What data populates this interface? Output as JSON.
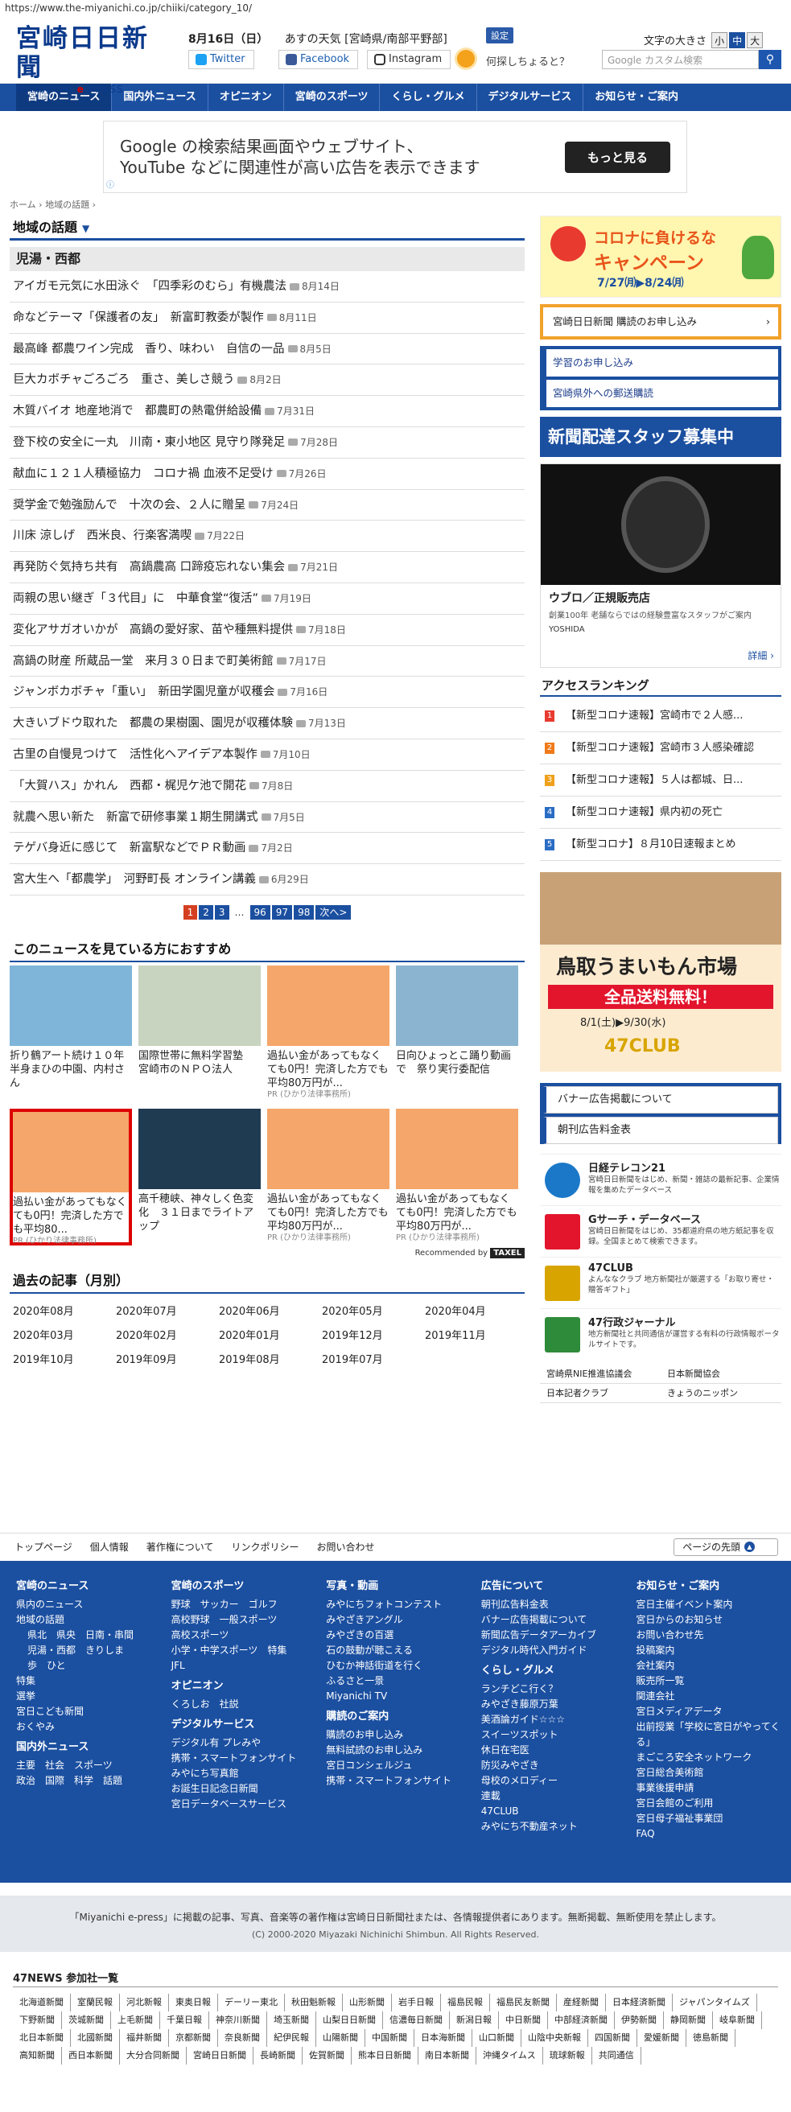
{
  "browser": {
    "url": "https://www.the-miyanichi.co.jp/chiiki/category_10/"
  },
  "header": {
    "logo_main": "宮崎日日新聞",
    "logo_sub_a": "MIYANICHI ",
    "logo_sub_b": "e",
    "logo_sub_c": "-PRESS",
    "date": "8月16日（日）",
    "weather": "あすの天気 [宮崎県/南部平野部]",
    "settings": "設定",
    "font_size_label": "文字の大きさ",
    "font_sizes": [
      "小",
      "中",
      "大"
    ],
    "twitter": "Twitter",
    "facebook": "Facebook",
    "instagram": "Instagram",
    "ask": "何探しちょると？",
    "search_placeholder": "Google カスタム検索",
    "search_icon": "search-icon"
  },
  "nav": [
    "宮崎のニュース",
    "国内外ニュース",
    "オピニオン",
    "宮崎のスポーツ",
    "くらし・グルメ",
    "デジタルサービス",
    "お知らせ・ご案内"
  ],
  "ad_top": {
    "text1": "Google の検索結果画面やウェブサイト、",
    "text2": "YouTube などに関連性が高い広告を表示できます",
    "button": "もっと見る",
    "info": "ⓘ"
  },
  "breadcrumb": {
    "home": "ホーム",
    "sep": "›",
    "current": "地域の話題",
    "end": "›"
  },
  "section_title": "地域の話題",
  "section_arrow": "▼",
  "subsection": "児湯・西都",
  "articles": [
    {
      "title": "アイガモ元気に水田泳ぐ　「四季彩のむら」有機農法",
      "date": "8月14日"
    },
    {
      "title": "命などテーマ「保護者の友」　新富町教委が製作",
      "date": "8月11日"
    },
    {
      "title": "最高峰 都農ワイン完成　香り、味わい　自信の一品",
      "date": "8月5日"
    },
    {
      "title": "巨大カボチャごろごろ　重さ、美しさ競う",
      "date": "8月2日"
    },
    {
      "title": "木質バイオ 地産地消で　都農町の熱電併給設備",
      "date": "7月31日"
    },
    {
      "title": "登下校の安全に一丸　川南・東小地区 見守り隊発足",
      "date": "7月28日"
    },
    {
      "title": "献血に１２１人積極協力　コロナ禍 血液不足受け",
      "date": "7月26日"
    },
    {
      "title": "奨学金で勉強励んで　十次の会、２人に贈呈",
      "date": "7月24日"
    },
    {
      "title": "川床 涼しげ　西米良、行楽客満喫",
      "date": "7月22日"
    },
    {
      "title": "再発防ぐ気持ち共有　高鍋農高 口蹄疫忘れない集会",
      "date": "7月21日"
    },
    {
      "title": "両親の思い継ぎ「３代目」に　中華食堂“復活”",
      "date": "7月19日"
    },
    {
      "title": "変化アサガオいかが　高鍋の愛好家、苗や種無料提供",
      "date": "7月18日"
    },
    {
      "title": "高鍋の財産 所蔵品一堂　来月３０日まで町美術館",
      "date": "7月17日"
    },
    {
      "title": "ジャンボカボチャ「重い」　新田学園児童が収穫会",
      "date": "7月16日"
    },
    {
      "title": "大きいブドウ取れた　都農の果樹園、園児が収穫体験",
      "date": "7月13日"
    },
    {
      "title": "古里の自慢見つけて　活性化ヘアイデア本製作",
      "date": "7月10日"
    },
    {
      "title": "「大賀ハス」かれん　西都・梶児ケ池で開花",
      "date": "7月8日"
    },
    {
      "title": "就農へ思い新た　新富で研修事業１期生開講式",
      "date": "7月5日"
    },
    {
      "title": "テゲバ身近に感じて　新富駅などでＰＲ動画",
      "date": "7月2日"
    },
    {
      "title": "宮大生へ「都農学」　河野町長 オンライン講義",
      "date": "6月29日"
    }
  ],
  "pager": {
    "pages": [
      "1",
      "2",
      "3",
      "…",
      "96",
      "97",
      "98",
      "次へ>"
    ]
  },
  "recommend_title": "このニュースを見ている方におすすめ",
  "recommend": [
    {
      "text": "折り鶴アート続け１０年 半身まひの中園、内村さん",
      "pr": ""
    },
    {
      "text": "国際世帯に無料学習塾　宮崎市のＮＰＯ法人",
      "pr": ""
    },
    {
      "text": "過払い金があってもなくても0円！完済した方でも平均80万円が...",
      "pr": "PR (ひかり法律事務所)"
    },
    {
      "text": "日向ひょっとこ踊り動画で　祭り実行委配信",
      "pr": ""
    },
    {
      "text": "過払い金があってもなくても0円！完済した方でも平均80...",
      "pr": "PR (ひかり法律事務所)"
    },
    {
      "text": "高千穂峡、神々しく色変化　３１日までライトアップ",
      "pr": ""
    },
    {
      "text": "過払い金があってもなくても0円！完済した方でも平均80万円が...",
      "pr": "PR (ひかり法律事務所)"
    },
    {
      "text": "過払い金があってもなくても0円！完済した方でも平均80万円が...",
      "pr": "PR (ひかり法律事務所)"
    }
  ],
  "recommended_by": "Recommended by",
  "recommended_logo": "TAXEL",
  "past_title": "過去の記事（月別）",
  "months": [
    "2020年08月",
    "2020年07月",
    "2020年06月",
    "2020年05月",
    "2020年04月",
    "2020年03月",
    "2020年02月",
    "2020年01月",
    "2019年12月",
    "2019年11月",
    "2019年10月",
    "2019年09月",
    "2019年08月",
    "2019年07月"
  ],
  "side": {
    "campaign_a": "コロナに負けるな",
    "campaign_b": "キャンペーン",
    "campaign_dates": "7/27㈪▶8/24㈪",
    "subscribe": "宮崎日日新聞 購読のお申し込み",
    "gakusyu": "学習のお申し込み",
    "outside": "宮崎県外への郵送購読",
    "staff": "新聞配達スタッフ募集中",
    "watch_title": "ウブロ／正規販売店",
    "watch_desc": "創業100年 老舗ならではの経験豊富なスタッフがご案内",
    "watch_brand": "YOSHIDA",
    "watch_more": "詳細 ›",
    "ranking_title": "アクセスランキング",
    "ranking": [
      {
        "n": "1",
        "t": "【新型コロナ速報】宮崎市で２人感..."
      },
      {
        "n": "2",
        "t": "【新型コロナ速報】宮崎市３人感染確認"
      },
      {
        "n": "3",
        "t": "【新型コロナ速報】５人は都城、日..."
      },
      {
        "n": "4",
        "t": "【新型コロナ速報】県内初の死亡"
      },
      {
        "n": "5",
        "t": "【新型コロナ】８月10日速報まとめ"
      }
    ],
    "tottori_a": "鳥取うまいもん市場",
    "tottori_b": "全品送料無料！",
    "tottori_dates": "8/1(土)▶9/30(水)",
    "club": "47CLUB",
    "info_links": [
      "バナー広告掲載について",
      "朝刊広告料金表"
    ],
    "services": [
      {
        "h": "日経テレコン21",
        "p": "宮崎日日新聞をはじめ、新聞・雑誌の最新記事、企業情報を集めたデータベース"
      },
      {
        "h": "Gサーチ・データベース",
        "p": "宮崎日日新聞をはじめ、35都道府県の地方紙記事を収録。全国まとめて検索できます。"
      },
      {
        "h": "47CLUB",
        "p": "よんななクラブ 地方新聞社が厳選する「お取り寄せ・贈答ギフト」"
      },
      {
        "h": "47行政ジャーナル",
        "p": "地方新聞社と共同通信が運営する有料の行政情報ポータルサイトです。"
      }
    ],
    "links": [
      "宮崎県NIE推進協議会",
      "日本新聞協会",
      "日本記者クラブ",
      "きょうのニッポン"
    ]
  },
  "footlinks": [
    "トップページ",
    "個人情報",
    "著作権について",
    "リンクポリシー",
    "お問い合わせ"
  ],
  "pagetop": "ページの先頭",
  "footer": {
    "col1": {
      "h": "宮崎のニュース",
      "items": [
        "県内のニュース",
        "地域の話題"
      ],
      "areas": [
        [
          "県北",
          "県央",
          "日南・串間"
        ],
        [
          "児湯・西都",
          "きりしま"
        ],
        [
          "歩",
          "ひと"
        ]
      ],
      "more": [
        "特集",
        "選挙",
        "宮日こども新聞",
        "おくやみ"
      ],
      "h2": "国内外ニュース",
      "world": [
        [
          "主要",
          "社会",
          "スポーツ"
        ],
        [
          "政治",
          "国際",
          "科学",
          "話題"
        ]
      ]
    },
    "col2": {
      "h": "宮崎のスポーツ",
      "rows": [
        [
          "野球",
          "サッカー",
          "ゴルフ"
        ],
        [
          "高校野球",
          "一般スポーツ"
        ],
        [
          "高校スポーツ"
        ],
        [
          "小学・中学スポーツ",
          "特集"
        ],
        [
          "JFL"
        ]
      ],
      "h2": "オピニオン",
      "op": [
        [
          "くろしお",
          "社説"
        ]
      ],
      "h3": "デジタルサービス",
      "digital": [
        "デジタル有 プレみや",
        "携帯・スマートフォンサイト",
        "みやにち写真館",
        "お誕生日記念日新聞",
        "宮日データベースサービス"
      ]
    },
    "col3": {
      "h": "写真・動画",
      "items": [
        "みやにちフォトコンテスト",
        "みやざきアングル",
        "みやざきの百選",
        "石の鼓動が聴こえる",
        "ひむか神話街道を行く",
        "ふるさと一景",
        "Miyanichi TV"
      ],
      "h2": "購読のご案内",
      "items2": [
        "購読のお申し込み",
        "無料試読のお申し込み",
        "宮日コンシェルジュ",
        "携帯・スマートフォンサイト"
      ]
    },
    "col4": {
      "h": "広告について",
      "items": [
        "朝刊広告料金表",
        "バナー広告掲載について",
        "新聞広告データアーカイブ",
        "デジタル時代入門ガイド"
      ],
      "h2": "くらし・グルメ",
      "items2": [
        "ランチどこ行く？",
        "みやざき藤原万葉",
        "美酒論ガイド☆☆☆",
        "スイーツスポット",
        "休日在宅医",
        "防災みやざき",
        "母校のメロディー",
        "連載",
        "47CLUB",
        "みやにち不動産ネット"
      ]
    },
    "col5": {
      "h": "お知らせ・ご案内",
      "items": [
        "宮日主催イベント案内",
        "宮日からのお知らせ",
        "お問い合わせ先",
        "投稿案内",
        "会社案内",
        "販売所一覧",
        "関連会社",
        "宮日メディアデータ",
        "出前授業「学校に宮日がやってくる」",
        "まごころ安全ネットワーク",
        "宮日総合美術館",
        "事業後援申請",
        "宮日会館のご利用",
        "宮日母子福祉事業団",
        "FAQ"
      ]
    }
  },
  "copyright": {
    "notice": "「Miyanichi e-press」に掲載の記事、写真、音楽等の著作権は宮崎日日新聞社または、各情報提供者にあります。無断掲載、無断使用を禁止します。",
    "c": "(C) 2000-2020 Miyazaki Nichinichi Shimbun. All Rights Reserved."
  },
  "news47": {
    "h": "47NEWS 参加社一覧",
    "papers": [
      "北海道新聞",
      "室蘭民報",
      "河北新報",
      "東奥日報",
      "デーリー東北",
      "秋田魁新報",
      "山形新聞",
      "岩手日報",
      "福島民報",
      "福島民友新聞",
      "産経新聞",
      "日本経済新聞",
      "ジャパンタイムズ",
      "下野新聞",
      "茨城新聞",
      "上毛新聞",
      "千葉日報",
      "神奈川新聞",
      "埼玉新聞",
      "山梨日日新聞",
      "信濃毎日新聞",
      "新潟日報",
      "中日新聞",
      "中部経済新聞",
      "伊勢新聞",
      "静岡新聞",
      "岐阜新聞",
      "北日本新聞",
      "北國新聞",
      "福井新聞",
      "京都新聞",
      "奈良新聞",
      "紀伊民報",
      "山陽新聞",
      "中国新聞",
      "日本海新聞",
      "山口新聞",
      "山陰中央新報",
      "四国新聞",
      "愛媛新聞",
      "徳島新聞",
      "高知新聞",
      "西日本新聞",
      "大分合同新聞",
      "宮崎日日新聞",
      "長崎新聞",
      "佐賀新聞",
      "熊本日日新聞",
      "南日本新聞",
      "沖縄タイムス",
      "琉球新報",
      "共同通信"
    ]
  }
}
